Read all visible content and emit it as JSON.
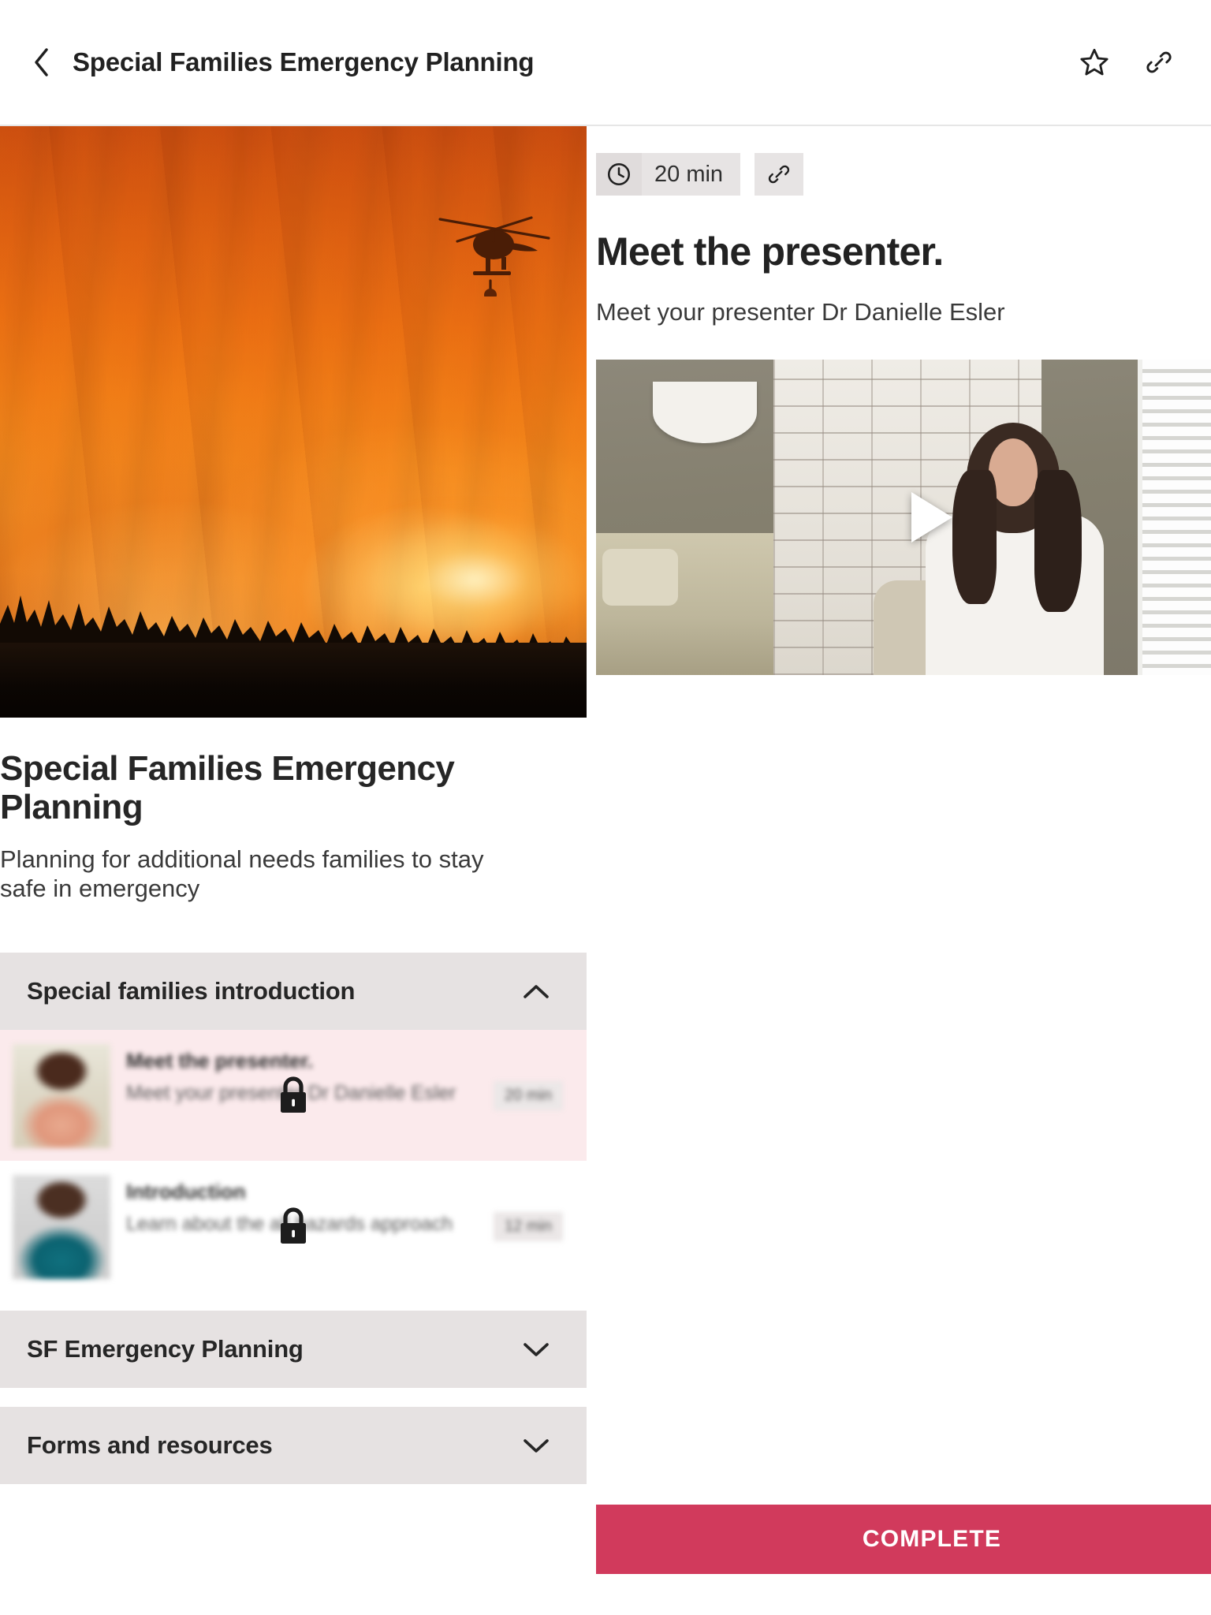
{
  "appbar": {
    "title": "Special Families Emergency Planning",
    "back_icon": "chevron-left-icon",
    "favorite_icon": "star-icon",
    "share_icon": "link-icon"
  },
  "course": {
    "title": "Special Families Emergency Planning",
    "description": "Planning for additional needs families to stay safe in emergency",
    "hero_image_alt": "wildfire-with-helicopter"
  },
  "sections": [
    {
      "label": "Special families introduction",
      "expanded": true,
      "chevron": "chevron-up-icon",
      "lessons": [
        {
          "title": "Meet the presenter.",
          "subtitle": "Meet your presenter Dr Danielle Esler",
          "duration": "20 min",
          "locked": true,
          "current": true,
          "lock_icon": "lock-icon"
        },
        {
          "title": "Introduction",
          "subtitle": "Learn about the all hazards approach",
          "duration": "12 min",
          "locked": true,
          "current": false,
          "lock_icon": "lock-icon"
        }
      ]
    },
    {
      "label": "SF Emergency Planning",
      "expanded": false,
      "chevron": "chevron-down-icon",
      "lessons": []
    },
    {
      "label": "Forms and resources",
      "expanded": false,
      "chevron": "chevron-down-icon",
      "lessons": []
    }
  ],
  "lesson_panel": {
    "duration": "20 min",
    "clock_icon": "clock-icon",
    "link_icon": "link-icon",
    "heading": "Meet the presenter.",
    "summary": "Meet your presenter Dr Danielle Esler",
    "video_alt": "presenter-video-thumbnail",
    "play_icon": "play-icon",
    "complete_label": "COMPLETE"
  },
  "colors": {
    "accent": "#d13a5c",
    "accordion_bg": "#e6e2e2",
    "current_lesson_bg": "#fbeaec",
    "badge_bg": "#e7e4e4",
    "text": "#262626"
  }
}
